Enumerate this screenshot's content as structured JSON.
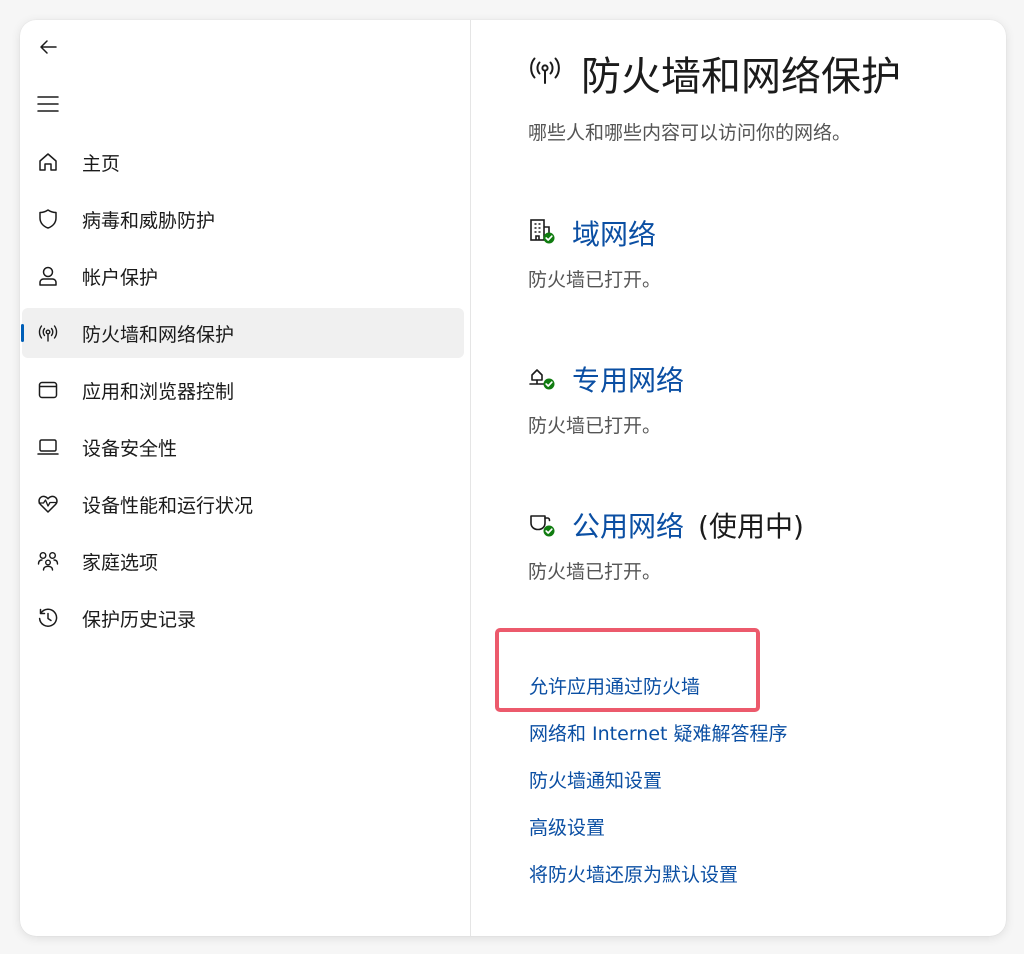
{
  "sidebar": {
    "back_icon": "back-arrow-icon",
    "menu_icon": "hamburger-menu-icon",
    "items": [
      {
        "label": "主页",
        "icon": "home-icon"
      },
      {
        "label": "病毒和威胁防护",
        "icon": "shield-icon"
      },
      {
        "label": "帐户保护",
        "icon": "person-icon"
      },
      {
        "label": "防火墙和网络保护",
        "icon": "wireless-antenna-icon",
        "selected": true
      },
      {
        "label": "应用和浏览器控制",
        "icon": "app-window-icon"
      },
      {
        "label": "设备安全性",
        "icon": "laptop-icon"
      },
      {
        "label": "设备性能和运行状况",
        "icon": "heart-pulse-icon"
      },
      {
        "label": "家庭选项",
        "icon": "family-icon"
      },
      {
        "label": "保护历史记录",
        "icon": "history-icon"
      }
    ]
  },
  "main": {
    "title": "防火墙和网络保护",
    "subtitle": "哪些人和哪些内容可以访问你的网络。",
    "networks": [
      {
        "name": "域网络",
        "status": "防火墙已打开。",
        "suffix": "",
        "icon": "domain-network-icon"
      },
      {
        "name": "专用网络",
        "status": "防火墙已打开。",
        "suffix": "",
        "icon": "private-network-icon"
      },
      {
        "name": "公用网络",
        "status": "防火墙已打开。",
        "suffix": "(使用中)",
        "icon": "public-network-icon"
      }
    ],
    "links": [
      "允许应用通过防火墙",
      "网络和 Internet 疑难解答程序",
      "防火墙通知设置",
      "高级设置",
      "将防火墙还原为默认设置"
    ]
  },
  "colors": {
    "accent": "#005fb8",
    "link": "#0b4fa3",
    "status_ok": "#107c10",
    "highlight": "#ec5a6c"
  }
}
